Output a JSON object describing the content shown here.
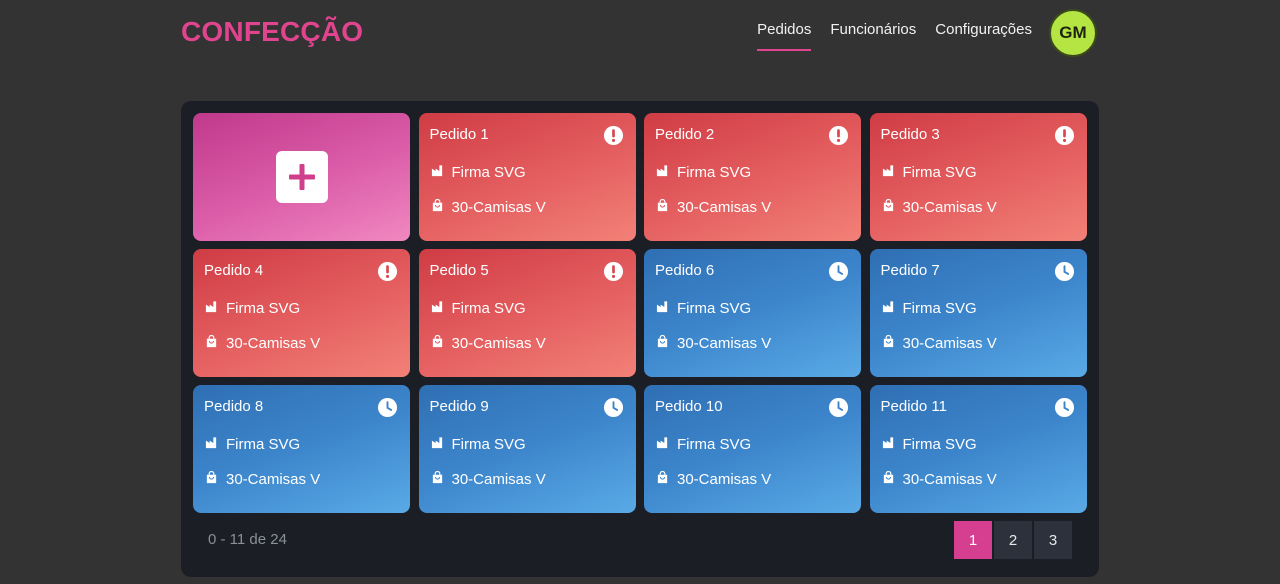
{
  "header": {
    "brand": "CONFECÇÃO",
    "nav": [
      {
        "label": "Pedidos",
        "active": true
      },
      {
        "label": "Funcionários",
        "active": false
      },
      {
        "label": "Configurações",
        "active": false
      }
    ],
    "avatar_initials": "GM"
  },
  "colors": {
    "accent": "#e0448e",
    "avatar": "#b5e543",
    "alert_card": "#e35c5e",
    "pending_card": "#3d86cc",
    "panel": "#1b1e24"
  },
  "add_card": {
    "icon": "plus-icon"
  },
  "orders": [
    {
      "title": "Pedido 1",
      "client": "Firma SVG",
      "item": "30-Camisas V",
      "status": "alert"
    },
    {
      "title": "Pedido 2",
      "client": "Firma SVG",
      "item": "30-Camisas V",
      "status": "alert"
    },
    {
      "title": "Pedido 3",
      "client": "Firma SVG",
      "item": "30-Camisas V",
      "status": "alert"
    },
    {
      "title": "Pedido 4",
      "client": "Firma SVG",
      "item": "30-Camisas V",
      "status": "alert"
    },
    {
      "title": "Pedido 5",
      "client": "Firma SVG",
      "item": "30-Camisas V",
      "status": "alert"
    },
    {
      "title": "Pedido 6",
      "client": "Firma SVG",
      "item": "30-Camisas V",
      "status": "pending"
    },
    {
      "title": "Pedido 7",
      "client": "Firma SVG",
      "item": "30-Camisas V",
      "status": "pending"
    },
    {
      "title": "Pedido 8",
      "client": "Firma SVG",
      "item": "30-Camisas V",
      "status": "pending"
    },
    {
      "title": "Pedido 9",
      "client": "Firma SVG",
      "item": "30-Camisas V",
      "status": "pending"
    },
    {
      "title": "Pedido 10",
      "client": "Firma SVG",
      "item": "30-Camisas V",
      "status": "pending"
    },
    {
      "title": "Pedido 11",
      "client": "Firma SVG",
      "item": "30-Camisas V",
      "status": "pending"
    }
  ],
  "pagination": {
    "range_text": "0 - 11 de 24",
    "pages": [
      "1",
      "2",
      "3"
    ],
    "current": "1"
  }
}
